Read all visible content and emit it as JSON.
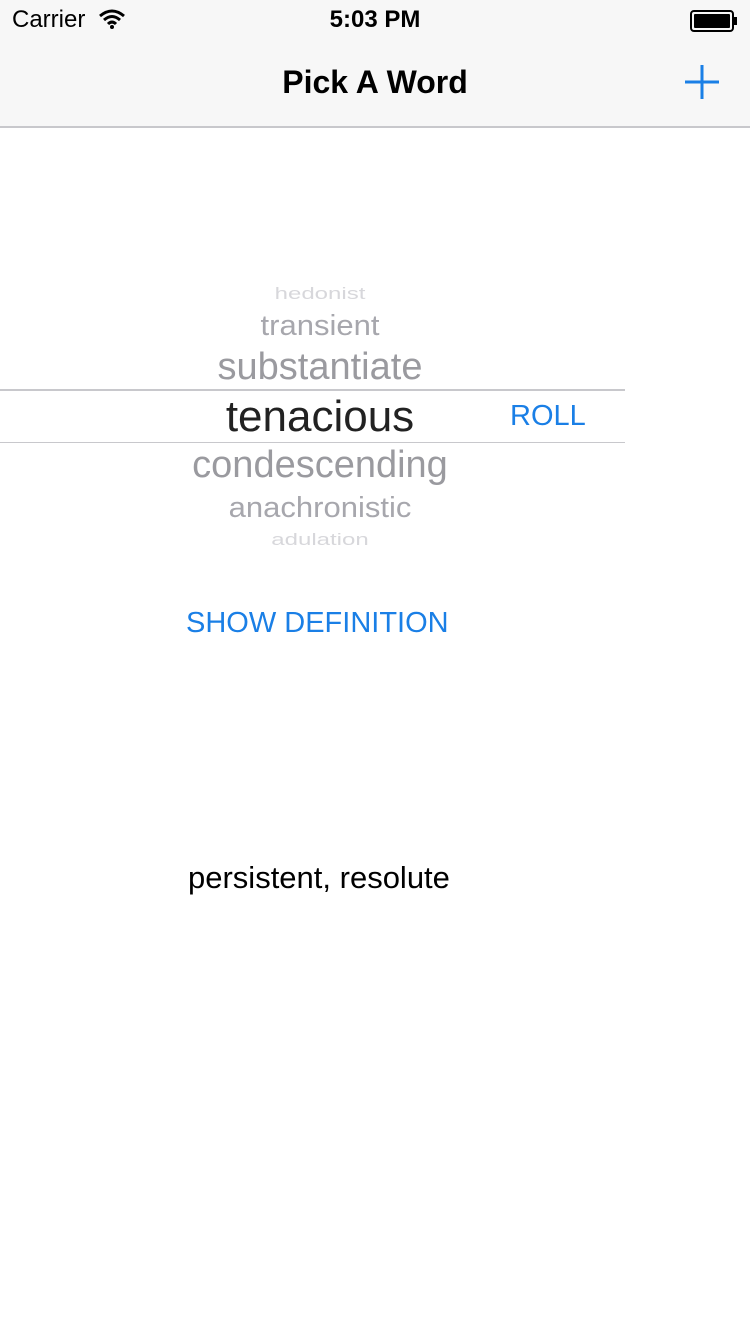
{
  "status_bar": {
    "carrier": "Carrier",
    "time": "5:03 PM",
    "wifi_icon": "wifi-icon",
    "battery_icon": "battery-icon"
  },
  "nav": {
    "title": "Pick A Word",
    "add_icon": "plus-icon",
    "accent_color": "#1a7fe6"
  },
  "picker": {
    "words": [
      "hedonist",
      "transient",
      "substantiate",
      "tenacious",
      "condescending",
      "anachronistic",
      "adulation"
    ],
    "selected": "tenacious"
  },
  "buttons": {
    "roll_label": "ROLL",
    "show_definition_label": "SHOW DEFINITION"
  },
  "definition": {
    "text": "persistent, resolute"
  }
}
